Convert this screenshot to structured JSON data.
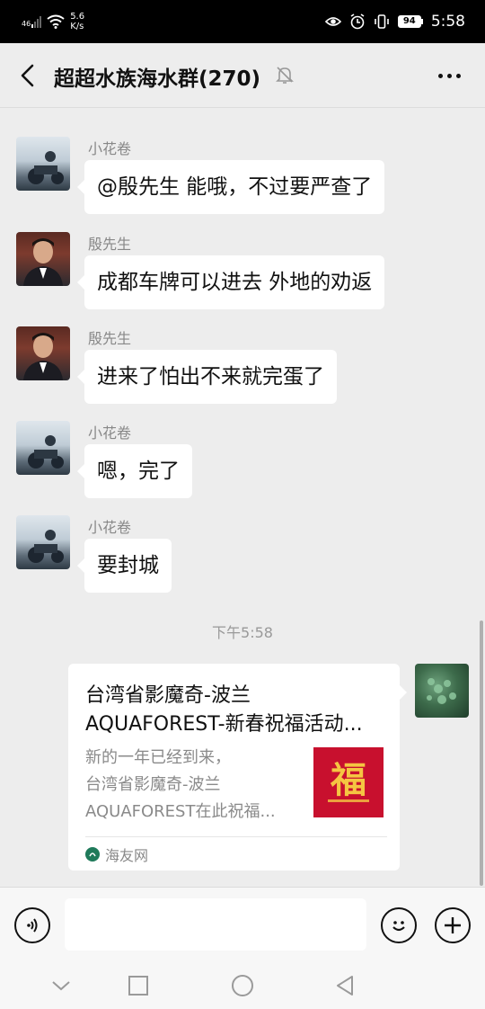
{
  "status_bar": {
    "signal": "46",
    "speed_value": "5.6",
    "speed_unit": "K/s",
    "battery": "94",
    "time": "5:58"
  },
  "header": {
    "title": "超超水族海水群(270)",
    "icons": [
      "back-arrow-icon",
      "mute-bell-icon",
      "more-icon"
    ]
  },
  "messages": [
    {
      "sender": "小花卷",
      "text": "@殷先生  能哦，不过要严查了"
    },
    {
      "sender": "殷先生",
      "text": "成都车牌可以进去  外地的劝返"
    },
    {
      "sender": "殷先生",
      "text": "进来了怕出不来就完蛋了"
    },
    {
      "sender": "小花卷",
      "text": "嗯，完了"
    },
    {
      "sender": "小花卷",
      "text": "要封城"
    }
  ],
  "time_divider": "下午5:58",
  "link_card": {
    "title_line1": "台湾省影魔奇-波兰",
    "title_line2": "AQUAFOREST-新春祝福活动...",
    "desc_line1": "新的一年已经到来，",
    "desc_line2": "台湾省影魔奇-波兰",
    "desc_line3": "AQUAFOREST在此祝福...",
    "thumb_text": "福",
    "source": "海友网"
  },
  "input_bar": {
    "placeholder": "",
    "icons": [
      "voice-icon",
      "emoji-icon",
      "plus-icon"
    ]
  },
  "colors": {
    "background": "#ededed",
    "bubble": "#ffffff",
    "thumb_red": "#c8102e"
  }
}
